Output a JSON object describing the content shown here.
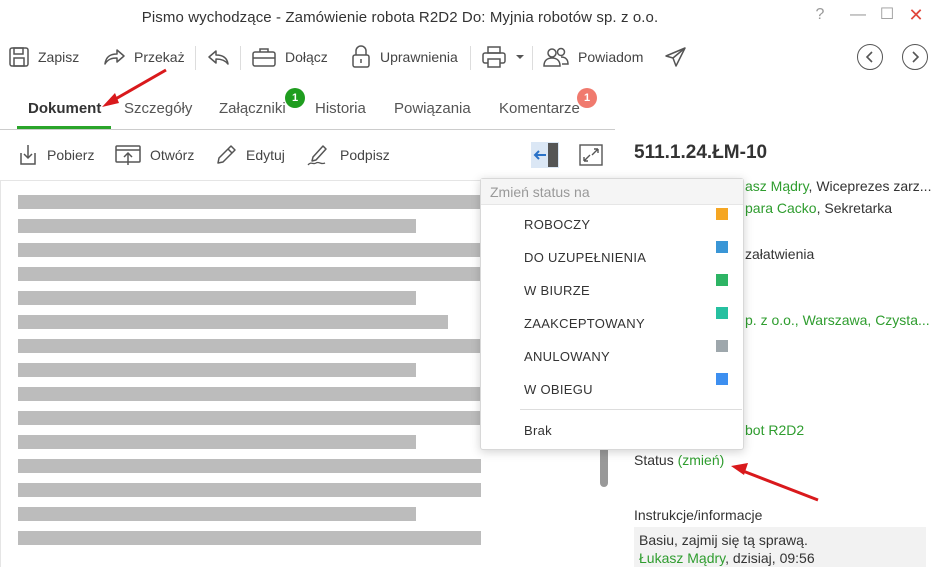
{
  "window": {
    "title": "Pismo wychodzące - Zamówienie robota R2D2 Do: Myjnia robotów sp. z o.o.",
    "help": "?",
    "minimize": "—",
    "maximize": "☐",
    "close": "✕"
  },
  "toolbar": {
    "save": "Zapisz",
    "forward": "Przekaż",
    "attach": "Dołącz",
    "permissions": "Uprawnienia",
    "notify": "Powiadom"
  },
  "tabs": [
    {
      "label": "Dokument"
    },
    {
      "label": "Szczegóły"
    },
    {
      "label": "Załączniki",
      "badge": "1"
    },
    {
      "label": "Historia"
    },
    {
      "label": "Powiązania"
    },
    {
      "label": "Komentarze",
      "badge": "1"
    }
  ],
  "doc_actions": {
    "download": "Pobierz",
    "open": "Otwórz",
    "edit": "Edytuj",
    "sign": "Podpisz"
  },
  "details": {
    "number": "511.1.24.ŁM-10",
    "person1_name": "asz Mądry",
    "person1_role": ", Wiceprezes zarz...",
    "person2_name": "para Cacko",
    "person2_role": ", Sekretarka",
    "resolution": "załatwienia",
    "recipient": "p. z o.o., Warszawa, Czysta...",
    "subject": "bot R2D2",
    "status_label": "Status",
    "status_change": "(zmień)",
    "instructions_label": "Instrukcje/informacje",
    "instruction_text": "Basiu, zajmij się tą sprawą.",
    "instruction_author": "Łukasz Mądry",
    "instruction_meta": ", dzisiaj, 09:56"
  },
  "status_menu": {
    "header": "Zmień status na",
    "items": [
      {
        "label": "ROBOCZY",
        "color": "#f5a623"
      },
      {
        "label": "DO UZUPEŁNIENIA",
        "color": "#3a96d6"
      },
      {
        "label": "W BIURZE",
        "color": "#2db464"
      },
      {
        "label": "ZAAKCEPTOWANY",
        "color": "#26c0a0"
      },
      {
        "label": "ANULOWANY",
        "color": "#9ea7ac"
      },
      {
        "label": "W OBIEGU",
        "color": "#3d8ff0"
      }
    ],
    "none": "Brak"
  },
  "colors": {
    "accent_green": "#2aa52a",
    "badge_green": "#1f9d1f",
    "badge_red": "#f07a6e",
    "annotation_red": "#d9191c"
  }
}
